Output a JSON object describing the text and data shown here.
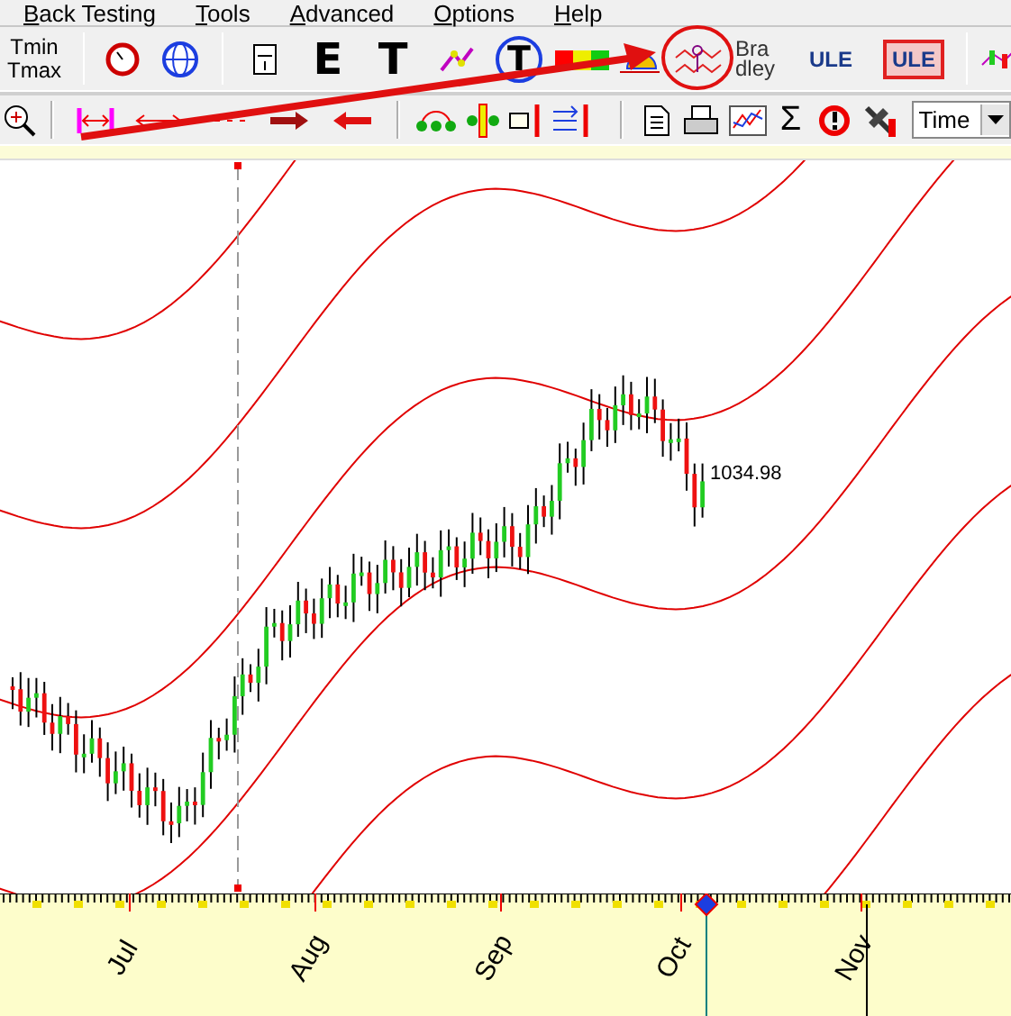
{
  "menu": [
    {
      "label": "Back Testing"
    },
    {
      "label": "Tools"
    },
    {
      "label": "Advanced"
    },
    {
      "label": "Options"
    },
    {
      "label": "Help"
    }
  ],
  "toolbar_top": {
    "tmin": "Tmin",
    "tmax": "Tmax",
    "e_label": "E",
    "t_label": "T",
    "globe_t_label": "T",
    "bradley_lines": [
      "Bra",
      "dley"
    ],
    "ule_buttons": [
      {
        "label": "ULE",
        "selected": false
      },
      {
        "label": "ULE",
        "selected": true
      }
    ]
  },
  "toolbar_bottom": {
    "sigma": "Σ",
    "timescale_dropdown": {
      "value": "Time"
    }
  },
  "chart": {
    "price_label": "1034.98"
  },
  "time_axis": {
    "months": [
      "Jul",
      "Aug",
      "Sep",
      "Oct",
      "Nov"
    ]
  }
}
